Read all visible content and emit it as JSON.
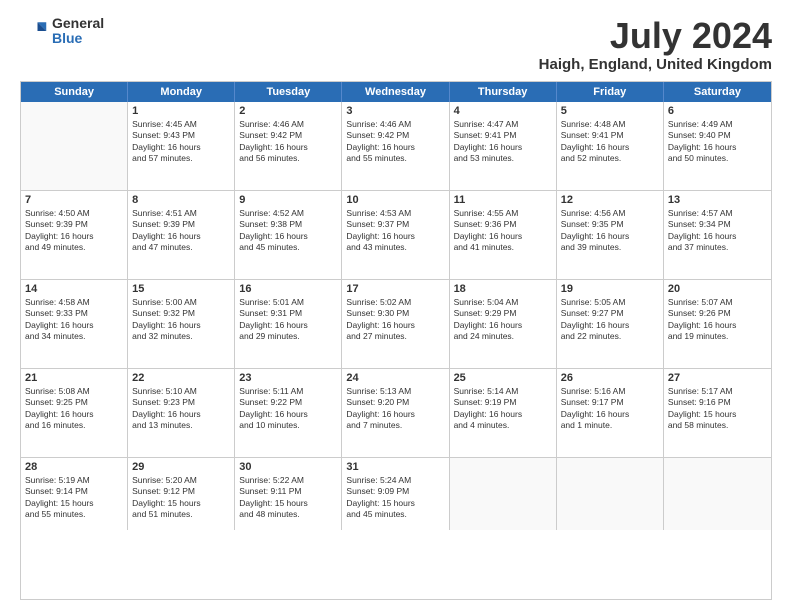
{
  "logo": {
    "general": "General",
    "blue": "Blue"
  },
  "title": "July 2024",
  "location": "Haigh, England, United Kingdom",
  "days": [
    "Sunday",
    "Monday",
    "Tuesday",
    "Wednesday",
    "Thursday",
    "Friday",
    "Saturday"
  ],
  "weeks": [
    [
      {
        "day": "",
        "content": ""
      },
      {
        "day": "1",
        "content": "Sunrise: 4:45 AM\nSunset: 9:43 PM\nDaylight: 16 hours\nand 57 minutes."
      },
      {
        "day": "2",
        "content": "Sunrise: 4:46 AM\nSunset: 9:42 PM\nDaylight: 16 hours\nand 56 minutes."
      },
      {
        "day": "3",
        "content": "Sunrise: 4:46 AM\nSunset: 9:42 PM\nDaylight: 16 hours\nand 55 minutes."
      },
      {
        "day": "4",
        "content": "Sunrise: 4:47 AM\nSunset: 9:41 PM\nDaylight: 16 hours\nand 53 minutes."
      },
      {
        "day": "5",
        "content": "Sunrise: 4:48 AM\nSunset: 9:41 PM\nDaylight: 16 hours\nand 52 minutes."
      },
      {
        "day": "6",
        "content": "Sunrise: 4:49 AM\nSunset: 9:40 PM\nDaylight: 16 hours\nand 50 minutes."
      }
    ],
    [
      {
        "day": "7",
        "content": "Sunrise: 4:50 AM\nSunset: 9:39 PM\nDaylight: 16 hours\nand 49 minutes."
      },
      {
        "day": "8",
        "content": "Sunrise: 4:51 AM\nSunset: 9:39 PM\nDaylight: 16 hours\nand 47 minutes."
      },
      {
        "day": "9",
        "content": "Sunrise: 4:52 AM\nSunset: 9:38 PM\nDaylight: 16 hours\nand 45 minutes."
      },
      {
        "day": "10",
        "content": "Sunrise: 4:53 AM\nSunset: 9:37 PM\nDaylight: 16 hours\nand 43 minutes."
      },
      {
        "day": "11",
        "content": "Sunrise: 4:55 AM\nSunset: 9:36 PM\nDaylight: 16 hours\nand 41 minutes."
      },
      {
        "day": "12",
        "content": "Sunrise: 4:56 AM\nSunset: 9:35 PM\nDaylight: 16 hours\nand 39 minutes."
      },
      {
        "day": "13",
        "content": "Sunrise: 4:57 AM\nSunset: 9:34 PM\nDaylight: 16 hours\nand 37 minutes."
      }
    ],
    [
      {
        "day": "14",
        "content": "Sunrise: 4:58 AM\nSunset: 9:33 PM\nDaylight: 16 hours\nand 34 minutes."
      },
      {
        "day": "15",
        "content": "Sunrise: 5:00 AM\nSunset: 9:32 PM\nDaylight: 16 hours\nand 32 minutes."
      },
      {
        "day": "16",
        "content": "Sunrise: 5:01 AM\nSunset: 9:31 PM\nDaylight: 16 hours\nand 29 minutes."
      },
      {
        "day": "17",
        "content": "Sunrise: 5:02 AM\nSunset: 9:30 PM\nDaylight: 16 hours\nand 27 minutes."
      },
      {
        "day": "18",
        "content": "Sunrise: 5:04 AM\nSunset: 9:29 PM\nDaylight: 16 hours\nand 24 minutes."
      },
      {
        "day": "19",
        "content": "Sunrise: 5:05 AM\nSunset: 9:27 PM\nDaylight: 16 hours\nand 22 minutes."
      },
      {
        "day": "20",
        "content": "Sunrise: 5:07 AM\nSunset: 9:26 PM\nDaylight: 16 hours\nand 19 minutes."
      }
    ],
    [
      {
        "day": "21",
        "content": "Sunrise: 5:08 AM\nSunset: 9:25 PM\nDaylight: 16 hours\nand 16 minutes."
      },
      {
        "day": "22",
        "content": "Sunrise: 5:10 AM\nSunset: 9:23 PM\nDaylight: 16 hours\nand 13 minutes."
      },
      {
        "day": "23",
        "content": "Sunrise: 5:11 AM\nSunset: 9:22 PM\nDaylight: 16 hours\nand 10 minutes."
      },
      {
        "day": "24",
        "content": "Sunrise: 5:13 AM\nSunset: 9:20 PM\nDaylight: 16 hours\nand 7 minutes."
      },
      {
        "day": "25",
        "content": "Sunrise: 5:14 AM\nSunset: 9:19 PM\nDaylight: 16 hours\nand 4 minutes."
      },
      {
        "day": "26",
        "content": "Sunrise: 5:16 AM\nSunset: 9:17 PM\nDaylight: 16 hours\nand 1 minute."
      },
      {
        "day": "27",
        "content": "Sunrise: 5:17 AM\nSunset: 9:16 PM\nDaylight: 15 hours\nand 58 minutes."
      }
    ],
    [
      {
        "day": "28",
        "content": "Sunrise: 5:19 AM\nSunset: 9:14 PM\nDaylight: 15 hours\nand 55 minutes."
      },
      {
        "day": "29",
        "content": "Sunrise: 5:20 AM\nSunset: 9:12 PM\nDaylight: 15 hours\nand 51 minutes."
      },
      {
        "day": "30",
        "content": "Sunrise: 5:22 AM\nSunset: 9:11 PM\nDaylight: 15 hours\nand 48 minutes."
      },
      {
        "day": "31",
        "content": "Sunrise: 5:24 AM\nSunset: 9:09 PM\nDaylight: 15 hours\nand 45 minutes."
      },
      {
        "day": "",
        "content": ""
      },
      {
        "day": "",
        "content": ""
      },
      {
        "day": "",
        "content": ""
      }
    ]
  ]
}
